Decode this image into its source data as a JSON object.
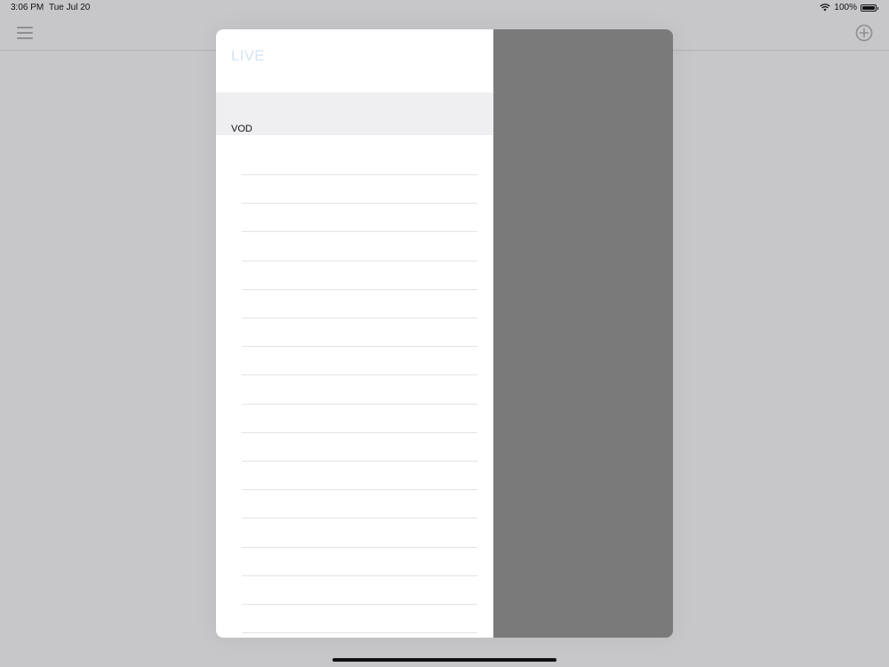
{
  "status_bar": {
    "time": "3:06 PM",
    "date": "Tue Jul 20",
    "battery": "100%"
  },
  "nav": {
    "menu_icon": "hamburger-menu-icon",
    "add_icon": "plus-circle-icon"
  },
  "menu": {
    "sections": [
      {
        "label": "LIVE"
      },
      {
        "label": "VOD"
      }
    ]
  },
  "colors": {
    "background": "#c7c7ca",
    "panel": "#ffffff",
    "overlay": "#7a7a7b",
    "live_label": "#d6e3f2"
  }
}
